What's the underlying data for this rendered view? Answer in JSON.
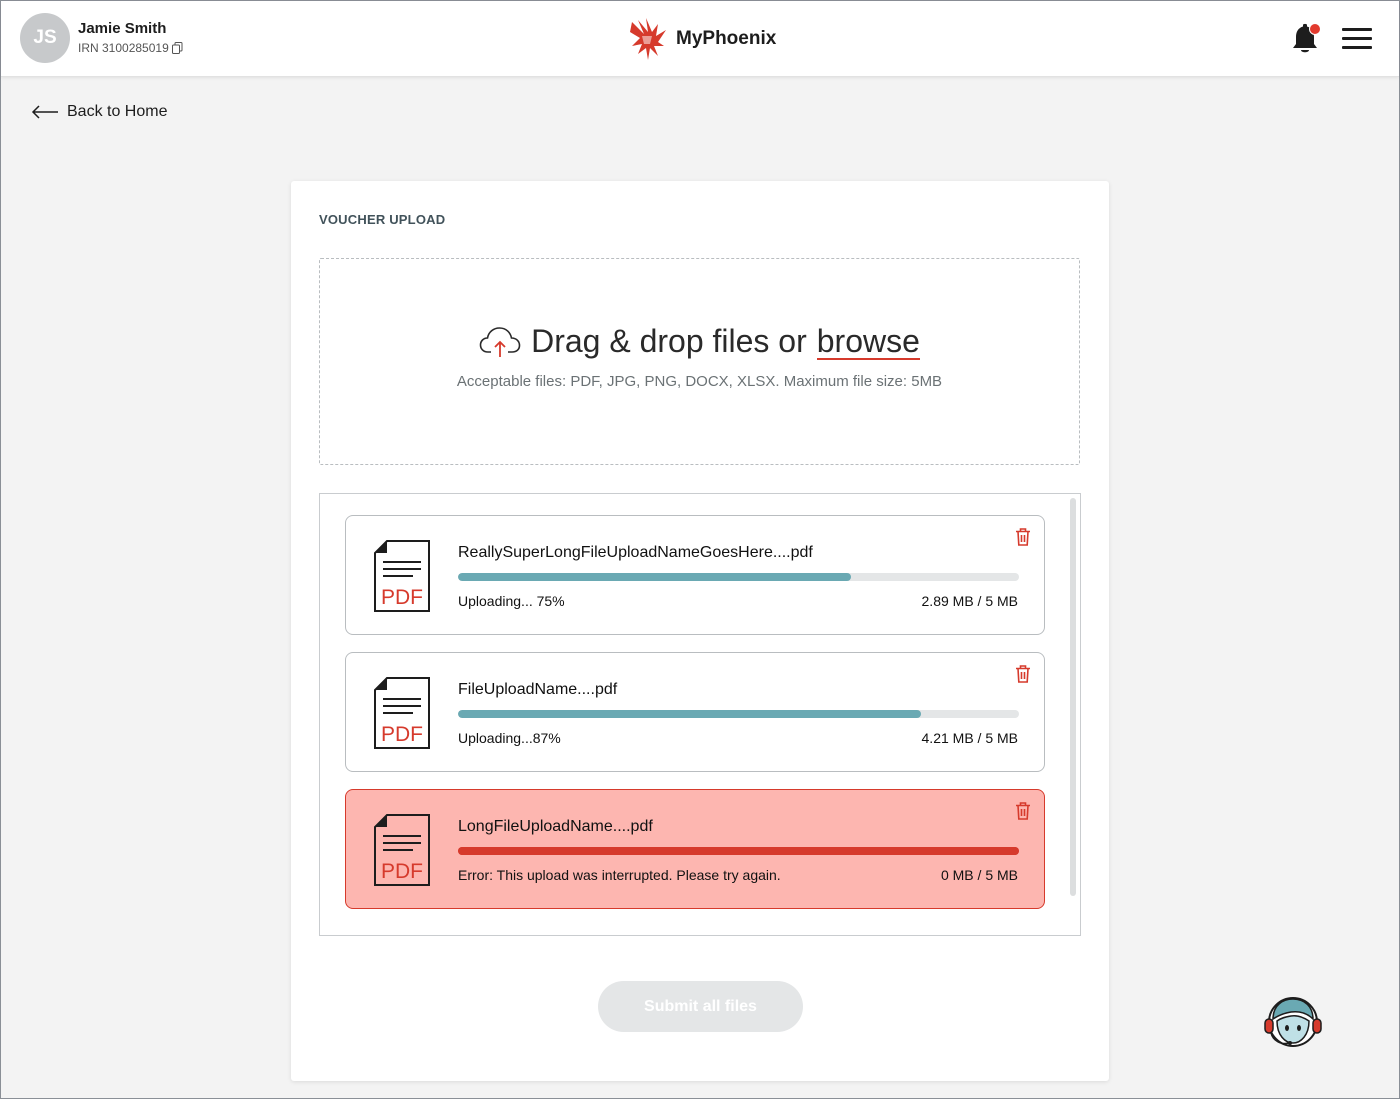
{
  "header": {
    "avatar_initials": "JS",
    "user_name": "Jamie Smith",
    "user_irn": "IRN 3100285019",
    "brand_name": "MyPhoenix",
    "icons": [
      "copy-icon",
      "phoenix-logo",
      "bell-icon",
      "menu-icon"
    ]
  },
  "nav": {
    "back_label": "Back to Home"
  },
  "upload": {
    "title": "VOUCHER UPLOAD",
    "drop_text": "Drag & drop files or",
    "browse_label": "browse",
    "accepted_text": "Acceptable files: PDF, JPG, PNG, DOCX, XLSX. Maximum file size: 5MB",
    "icon": "cloud-upload-icon"
  },
  "files": [
    {
      "name": "ReallySuperLongFileUploadNameGoesHere....pdf",
      "status": "Uploading... 75%",
      "size": "2.89 MB / 5 MB",
      "progress": 0.7,
      "state": "uploading",
      "icon_label": "PDF"
    },
    {
      "name": "FileUploadName....pdf",
      "status": "Uploading...87%",
      "size": "4.21 MB / 5 MB",
      "progress": 0.825,
      "state": "uploading",
      "icon_label": "PDF"
    },
    {
      "name": "LongFileUploadName....pdf",
      "status": "Error: This upload was interrupted. Please try again.",
      "size": "0 MB / 5 MB",
      "progress": 1.0,
      "state": "error",
      "icon_label": "PDF"
    }
  ],
  "actions": {
    "submit_label": "Submit all files"
  },
  "colors": {
    "accent_red": "#d63a2c",
    "progress_teal": "#6aa9b3",
    "error_bg": "#fdb6b0",
    "disabled_button": "#e4e6e7"
  }
}
